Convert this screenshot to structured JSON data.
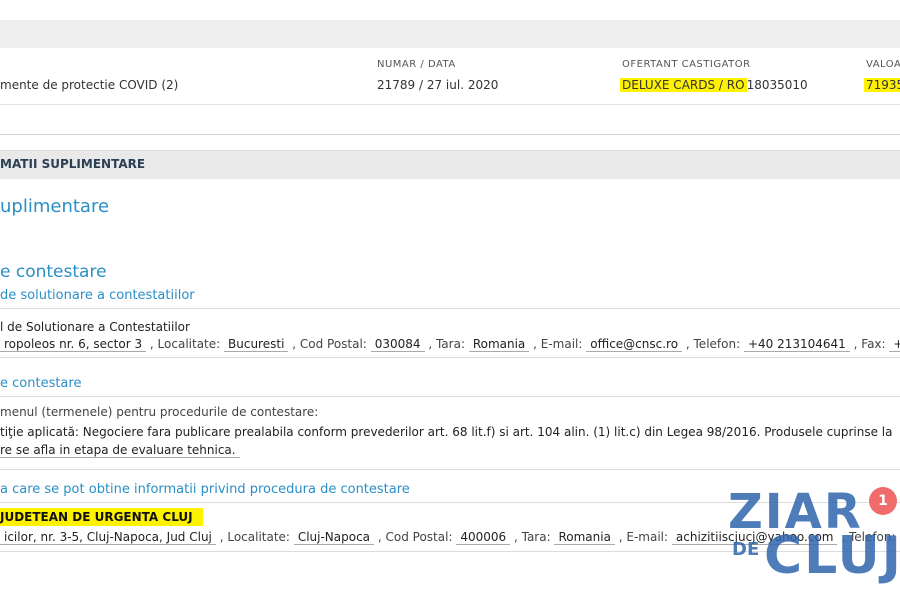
{
  "contract": {
    "headers": {
      "numar_data": "NUMAR / DATA",
      "ofertant": "OFERTANT CASTIGATOR",
      "valoare": "VALOA"
    },
    "row": {
      "obiect": "mente de protectie COVID (2)",
      "numar_data": "21789 / 27 iul. 2020",
      "ofertant_name": "DELUXE CARDS / RO",
      "ofertant_code": "18035010",
      "valoare": "71935"
    }
  },
  "section": {
    "title": "MATII SUPLIMENTARE"
  },
  "headings": {
    "suplimentare": "uplimentare",
    "contestare": "e contestare",
    "solutionare": "de solutionare a contestatiilor",
    "contestare_sub": "e contestare",
    "informatii": "a care se pot obtine informatii privind procedura de contestare"
  },
  "cnsc": {
    "name": "l de Solutionare a Contestatiilor",
    "address": "ropoleos nr. 6, sector 3",
    "localitate_label": ", Localitate:",
    "localitate": "Bucuresti",
    "cod_label": ", Cod Postal:",
    "cod": "030084",
    "tara_label": ", Tara:",
    "tara": "Romania",
    "email_label": ", E-mail:",
    "email": "office@cnsc.ro",
    "telefon_label": ", Telefon:",
    "telefon": "+40 213104641",
    "fax_label": ", Fax:",
    "fax": "+"
  },
  "termen": {
    "line1": "menul (termenele) pentru procedurile de contestare:",
    "line2": "tiţie aplicată: Negociere fara publicare prealabila conform prevederilor art. 68 lit.f) si art. 104 alin. (1) lit.c) din Legea 98/2016. Produsele cuprinse la",
    "line3": "re se afla in etapa de evaluare tehnica."
  },
  "spital": {
    "name": "JUDETEAN DE URGENTA CLUJ",
    "address": "icilor, nr. 3-5, Cluj-Napoca, Jud Cluj",
    "localitate_label": ", Localitate:",
    "localitate": "Cluj-Napoca",
    "cod_label": ", Cod Postal:",
    "cod": "400006",
    "tara_label": ", Tara:",
    "tara": "Romania",
    "email_label": ", E-mail:",
    "email": "achizitiiscjucj@yahoo.com",
    "telefon_label": ", Telefon:"
  },
  "watermark": {
    "line1": "ZIAR",
    "line2": "DE",
    "line3": "CLUJ"
  },
  "notification": {
    "count": "1"
  },
  "colors": {
    "highlight": "#fff200",
    "link_blue": "#2a8fc7",
    "badge": "#f06b6b",
    "watermark": "#2f66ad"
  }
}
